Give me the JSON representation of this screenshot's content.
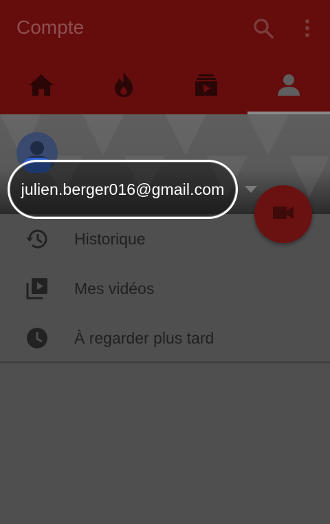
{
  "appbar": {
    "title": "Compte",
    "icons": [
      "search-icon",
      "more-vert-icon"
    ]
  },
  "tabs": [
    {
      "name": "home",
      "icon": "home-icon"
    },
    {
      "name": "trending",
      "icon": "flame-icon"
    },
    {
      "name": "subscriptions",
      "icon": "subscriptions-icon"
    },
    {
      "name": "account",
      "icon": "account-icon",
      "selected": true
    }
  ],
  "account": {
    "email": "julien.berger016@gmail.com"
  },
  "menu": {
    "items": [
      {
        "label": "Historique",
        "icon": "history-icon"
      },
      {
        "label": "Mes vidéos",
        "icon": "video-library-icon"
      },
      {
        "label": "À regarder plus tard",
        "icon": "clock-icon"
      }
    ]
  },
  "fab": {
    "icon": "video-camera-icon"
  },
  "colors": {
    "appbar": "#650c0c",
    "scrim": "#4f4f4f",
    "fab": "#6a1212",
    "touch": "#2c63d6"
  }
}
